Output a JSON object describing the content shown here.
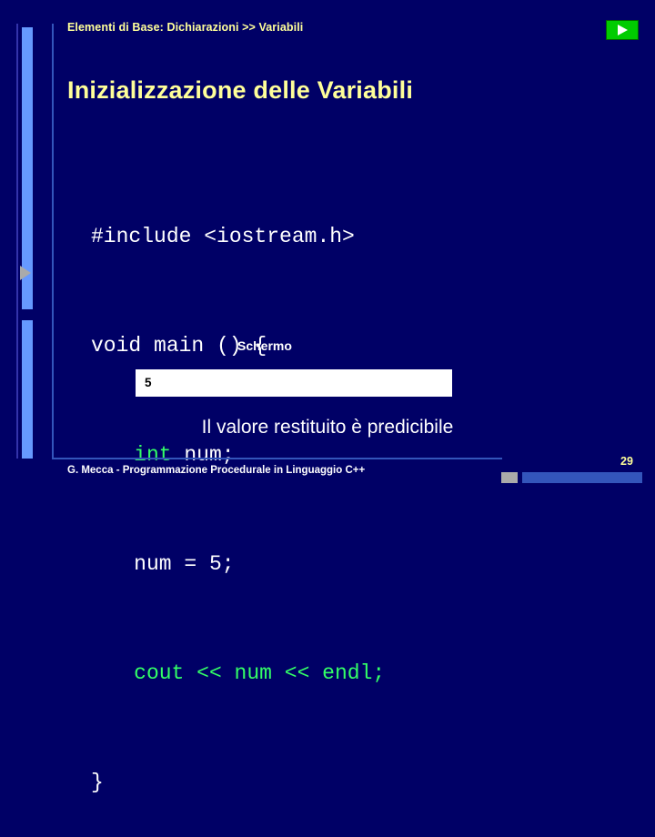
{
  "header": {
    "title": "Elementi di Base: Dichiarazioni >> Variabili",
    "nav_next_icon": "play-icon"
  },
  "slide": {
    "title": "Inizializzazione delle Variabili",
    "code_lines": [
      {
        "indent": 0,
        "tokens": [
          {
            "text": "#include <iostream.h>",
            "color": "white"
          }
        ]
      },
      {
        "indent": 0,
        "tokens": [
          {
            "text": "void main () {",
            "color": "white"
          }
        ]
      },
      {
        "indent": 1,
        "tokens": [
          {
            "text": "int",
            "color": "green"
          },
          {
            "text": " num;",
            "color": "white"
          }
        ]
      },
      {
        "indent": 1,
        "tokens": [
          {
            "text": "num = 5;",
            "color": "white"
          }
        ]
      },
      {
        "indent": 1,
        "tokens": [
          {
            "text": "cout << num << endl;",
            "color": "green"
          }
        ]
      },
      {
        "indent": 0,
        "tokens": [
          {
            "text": "}",
            "color": "white"
          }
        ]
      }
    ],
    "screen_label": "Schermo",
    "screen_value": "5",
    "caption": "Il valore restituito è predicibile"
  },
  "footer": {
    "text": "G. Mecca - Programmazione Procedurale in Linguaggio C++",
    "page_number": "29"
  },
  "colors": {
    "background": "#000066",
    "accent_yellow": "#ffff99",
    "code_green": "#33ff66",
    "bar_blue": "#6699ff",
    "rule_blue": "#3355bb",
    "play_green": "#00cc00"
  }
}
